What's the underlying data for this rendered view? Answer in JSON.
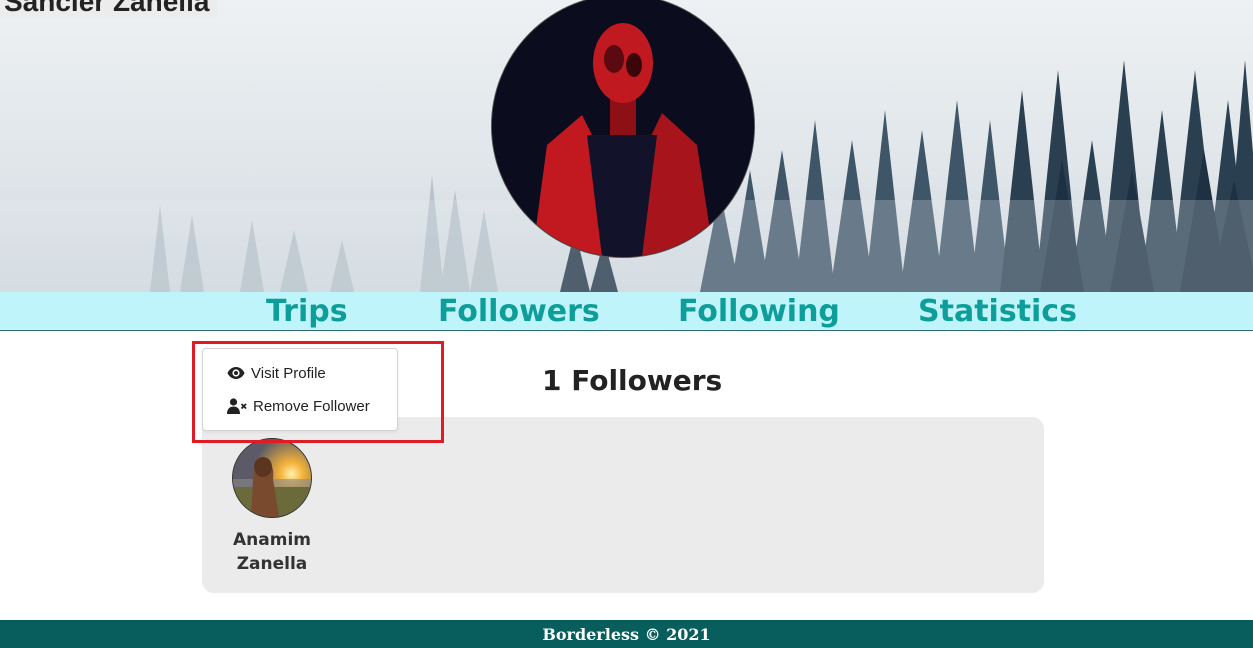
{
  "profile": {
    "name": "Sancler Zanella"
  },
  "tabs": [
    {
      "label": "Trips"
    },
    {
      "label": "Followers"
    },
    {
      "label": "Following"
    },
    {
      "label": "Statistics"
    }
  ],
  "followers_section": {
    "title": "1 Followers",
    "followers": [
      {
        "first_name": "Anamim",
        "last_name": "Zanella"
      }
    ]
  },
  "context_menu": {
    "visit_profile": "Visit Profile",
    "remove_follower": "Remove Follower",
    "visit_icon": "eye-icon",
    "remove_icon": "user-remove-icon"
  },
  "footer": {
    "text": "Borderless © 2021"
  },
  "colors": {
    "tab_bar_background": "#bff4fa",
    "tab_text": "#0e9e99",
    "footer_background": "#075e5c",
    "highlight_border": "#e01b24",
    "panel_background": "#ebebeb"
  }
}
